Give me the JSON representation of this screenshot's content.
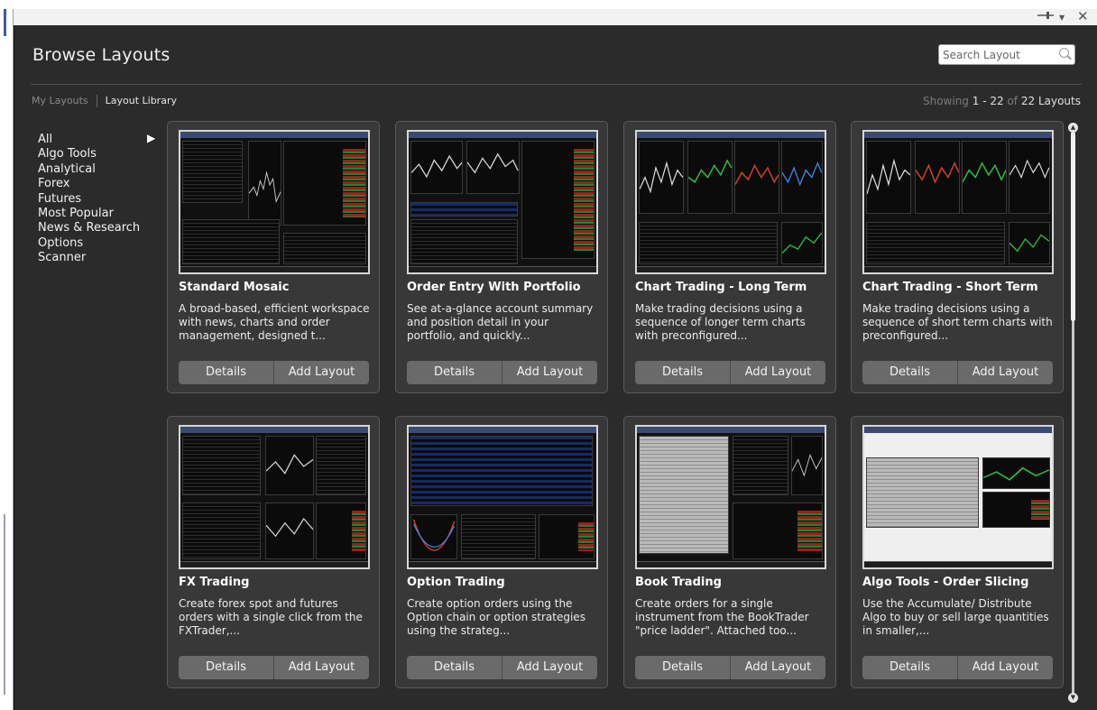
{
  "window": {
    "pin_icon": "pin-icon",
    "menu_icon": "chevron-down-icon",
    "close_glyph": "✕"
  },
  "header": {
    "title": "Browse Layouts",
    "search_placeholder": "Search Layout"
  },
  "tabs": {
    "my_layouts": "My Layouts",
    "layout_library": "Layout Library"
  },
  "showing": {
    "prefix": "Showing",
    "range": "1 - 22",
    "of": "of",
    "total": "22 Layouts"
  },
  "categories": [
    "All",
    "Algo Tools",
    "Analytical",
    "Forex",
    "Futures",
    "Most Popular",
    "News & Research",
    "Options",
    "Scanner"
  ],
  "buttons": {
    "details": "Details",
    "add_layout": "Add Layout"
  },
  "cards": [
    {
      "title": "Standard Mosaic",
      "desc": "A broad-based, efficient workspace with news, charts and order management, designed t..."
    },
    {
      "title": "Order Entry With Portfolio",
      "desc": "See at-a-glance account summary and position detail in your portfolio, and quickly..."
    },
    {
      "title": "Chart Trading - Long Term",
      "desc": "Make trading decisions using a sequence of longer term charts with preconfigured..."
    },
    {
      "title": "Chart Trading - Short Term",
      "desc": "Make trading decisions using a sequence of short term charts with preconfigured..."
    },
    {
      "title": "FX Trading",
      "desc": "Create forex spot and futures orders with a single click from the FXTrader,..."
    },
    {
      "title": "Option Trading",
      "desc": "Create option orders using the Option chain or option strategies using the strateg..."
    },
    {
      "title": "Book Trading",
      "desc": "Create orders for a single instrument from the BookTrader \"price ladder\". Attached too..."
    },
    {
      "title": "Algo Tools - Order Slicing",
      "desc": "Use the Accumulate/ Distribute Algo to buy or sell large quantities in smaller,..."
    }
  ]
}
